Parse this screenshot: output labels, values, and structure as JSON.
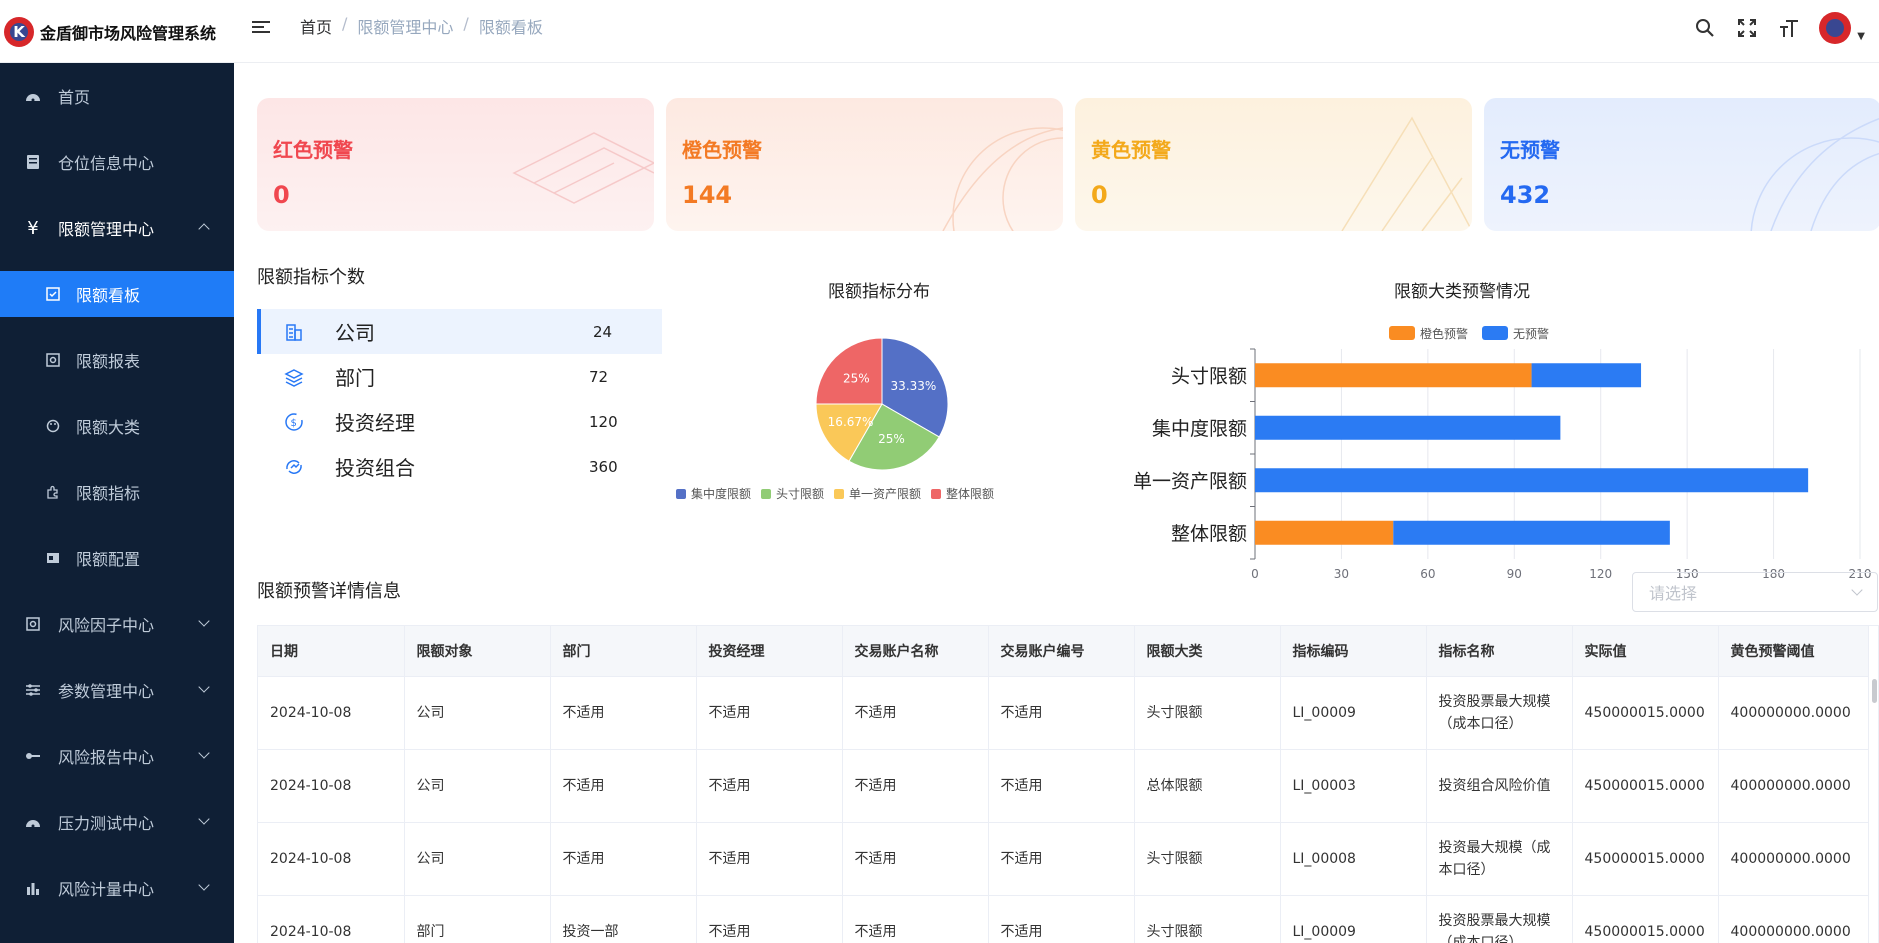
{
  "header": {
    "brand_title": "金盾御市场风险管理系统",
    "logo_letter": "K",
    "breadcrumb": [
      "首页",
      "限额管理中心",
      "限额看板"
    ]
  },
  "sidebar": {
    "items": [
      {
        "label": "首页",
        "icon": "dashboard-icon"
      },
      {
        "label": "仓位信息中心",
        "icon": "ledger-icon"
      },
      {
        "label": "限额管理中心",
        "icon": "yen-icon",
        "expanded": true
      },
      {
        "label": "限额看板",
        "icon": "checkbox-icon",
        "active": true
      },
      {
        "label": "限额报表",
        "icon": "report-icon"
      },
      {
        "label": "限额大类",
        "icon": "palette-icon"
      },
      {
        "label": "限额指标",
        "icon": "puzzle-icon"
      },
      {
        "label": "限额配置",
        "icon": "config-icon"
      },
      {
        "label": "风险因子中心",
        "icon": "factor-icon"
      },
      {
        "label": "参数管理中心",
        "icon": "sliders-icon"
      },
      {
        "label": "风险报告中心",
        "icon": "key-icon"
      },
      {
        "label": "压力测试中心",
        "icon": "gauge-icon"
      },
      {
        "label": "风险计量中心",
        "icon": "bar-chart-icon"
      }
    ]
  },
  "cards": [
    {
      "title": "红色预警",
      "value": "0",
      "color": "#f0474f"
    },
    {
      "title": "橙色预警",
      "value": "144",
      "color": "#f37a24"
    },
    {
      "title": "黄色预警",
      "value": "0",
      "color": "#f3a91b"
    },
    {
      "title": "无预警",
      "value": "432",
      "color": "#2469f1"
    }
  ],
  "counts": {
    "title": "限额指标个数",
    "rows": [
      {
        "label": "公司",
        "value": "24",
        "icon": "building-icon"
      },
      {
        "label": "部门",
        "value": "72",
        "icon": "layers-icon"
      },
      {
        "label": "投资经理",
        "value": "120",
        "icon": "money-icon"
      },
      {
        "label": "投资组合",
        "value": "360",
        "icon": "portfolio-icon"
      }
    ]
  },
  "chart_data": [
    {
      "type": "pie",
      "title": "限额指标分布",
      "categories": [
        "集中度限额",
        "头寸限额",
        "单一资产限额",
        "整体限额"
      ],
      "values": [
        33.33,
        25,
        16.67,
        25
      ],
      "labels": [
        "33.33%",
        "25%",
        "16.67%",
        "25%"
      ],
      "colors": [
        "#5470c6",
        "#91cc75",
        "#fac858",
        "#ee6666"
      ],
      "legend": "bottom"
    },
    {
      "type": "bar",
      "orientation": "horizontal",
      "stacked": true,
      "title": "限额大类预警情况",
      "categories": [
        "头寸限额",
        "集中度限额",
        "单一资产限额",
        "整体限额"
      ],
      "series": [
        {
          "name": "橙色预警",
          "values": [
            96,
            0,
            0,
            48
          ],
          "color": "#fa8c22"
        },
        {
          "name": "无预警",
          "values": [
            38,
            106,
            192,
            96
          ],
          "color": "#2b7bf3"
        }
      ],
      "xlim": [
        0,
        210
      ],
      "xticks": [
        0,
        30,
        60,
        90,
        120,
        150,
        180,
        210
      ],
      "legend": "top",
      "grid": true
    }
  ],
  "details": {
    "title": "限额预警详情信息",
    "select_placeholder": "请选择",
    "columns": [
      "日期",
      "限额对象",
      "部门",
      "投资经理",
      "交易账户名称",
      "交易账户编号",
      "限额大类",
      "指标编码",
      "指标名称",
      "实际值",
      "黄色预警阈值"
    ],
    "rows": [
      [
        "2024-10-08",
        "公司",
        "不适用",
        "不适用",
        "不适用",
        "不适用",
        "头寸限额",
        "LI_00009",
        "投资股票最大规模（成本口径）",
        "450000015.0000",
        "400000000.0000"
      ],
      [
        "2024-10-08",
        "公司",
        "不适用",
        "不适用",
        "不适用",
        "不适用",
        "总体限额",
        "LI_00003",
        "投资组合风险价值",
        "450000015.0000",
        "400000000.0000"
      ],
      [
        "2024-10-08",
        "公司",
        "不适用",
        "不适用",
        "不适用",
        "不适用",
        "头寸限额",
        "LI_00008",
        "投资最大规模（成本口径）",
        "450000015.0000",
        "400000000.0000"
      ],
      [
        "2024-10-08",
        "部门",
        "投资一部",
        "不适用",
        "不适用",
        "不适用",
        "头寸限额",
        "LI_00009",
        "投资股票最大规模（成本口径）",
        "450000015.0000",
        "400000000.0000"
      ]
    ]
  }
}
